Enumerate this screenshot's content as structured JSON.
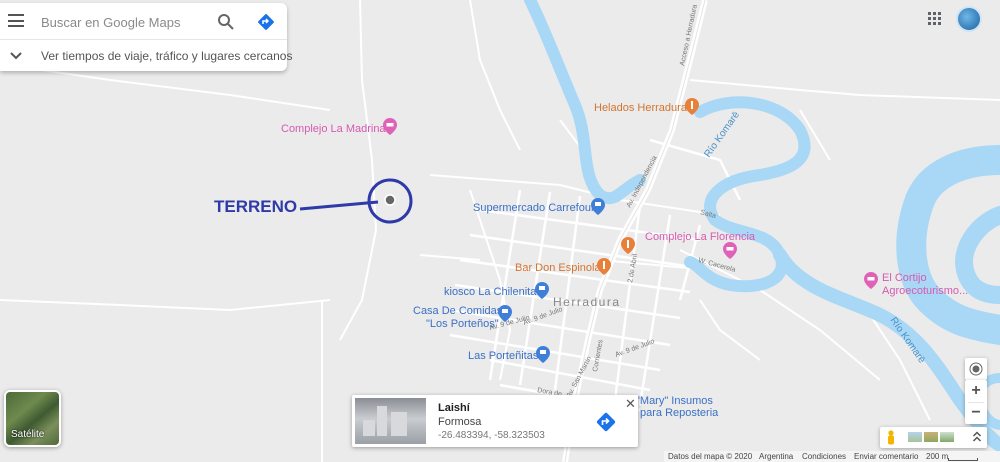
{
  "search": {
    "placeholder": "Buscar en Google Maps",
    "secondary_hint": "Ver tiempos de viaje, tráfico y lugares cercanos"
  },
  "annotation": {
    "label": "TERRENO",
    "color": "#2e3aa8"
  },
  "map_labels": {
    "town": "Herradura",
    "river": "Río Komarē",
    "places": [
      {
        "name": "Complejo La Madrina",
        "category": "hotel",
        "color": "#e062b8"
      },
      {
        "name": "Helados Herradura",
        "category": "food",
        "color": "#e8803a"
      },
      {
        "name": "Supermercado Carrefour",
        "category": "shopping",
        "color": "#3f7fd9"
      },
      {
        "name": "Complejo La Florencia",
        "category": "hotel",
        "color": "#e062b8"
      },
      {
        "name": "Bar Don Espinola",
        "category": "food",
        "color": "#e8803a"
      },
      {
        "name": "kiosco La Chilenita",
        "category": "shopping",
        "color": "#3f7fd9"
      },
      {
        "name": "Casa De Comidas",
        "name_line2": "\"Los Porteños\"",
        "category": "shopping",
        "color": "#3f7fd9"
      },
      {
        "name": "Las Porteñitas",
        "category": "shopping",
        "color": "#3f7fd9"
      },
      {
        "name": "El Cortijo",
        "name_line2": "Agroecoturismo...",
        "category": "hotel",
        "color": "#e062b8"
      },
      {
        "name": "\"Mary\" Insumos",
        "name_line2": "para Reposteria",
        "category": "shopping",
        "color": "#3f7fd9"
      }
    ],
    "streets": [
      "Acceso a Herradura",
      "Av. Independencia",
      "Av. San Martín",
      "Av. 9 de Julio",
      "Av. 9 de Julio",
      "Av. 9 de Julio",
      "Corrientes",
      "Dora de",
      "Salta",
      "W. Cacerela",
      "2 de Abril"
    ]
  },
  "place_card": {
    "title": "Laishí",
    "subtitle": "Formosa",
    "coords": "-26.483394, -58.323503",
    "close": "✕"
  },
  "satellite_label": "Satélite",
  "controls": {
    "zoom_in": "+",
    "zoom_out": "−"
  },
  "footer": {
    "data": "Datos del mapa © 2020",
    "country": "Argentina",
    "terms": "Condiciones",
    "feedback": "Enviar comentario",
    "scale": "200 m"
  },
  "colors": {
    "water": "#a8d8f5",
    "road": "#ffffff",
    "land": "#ebebeb"
  }
}
